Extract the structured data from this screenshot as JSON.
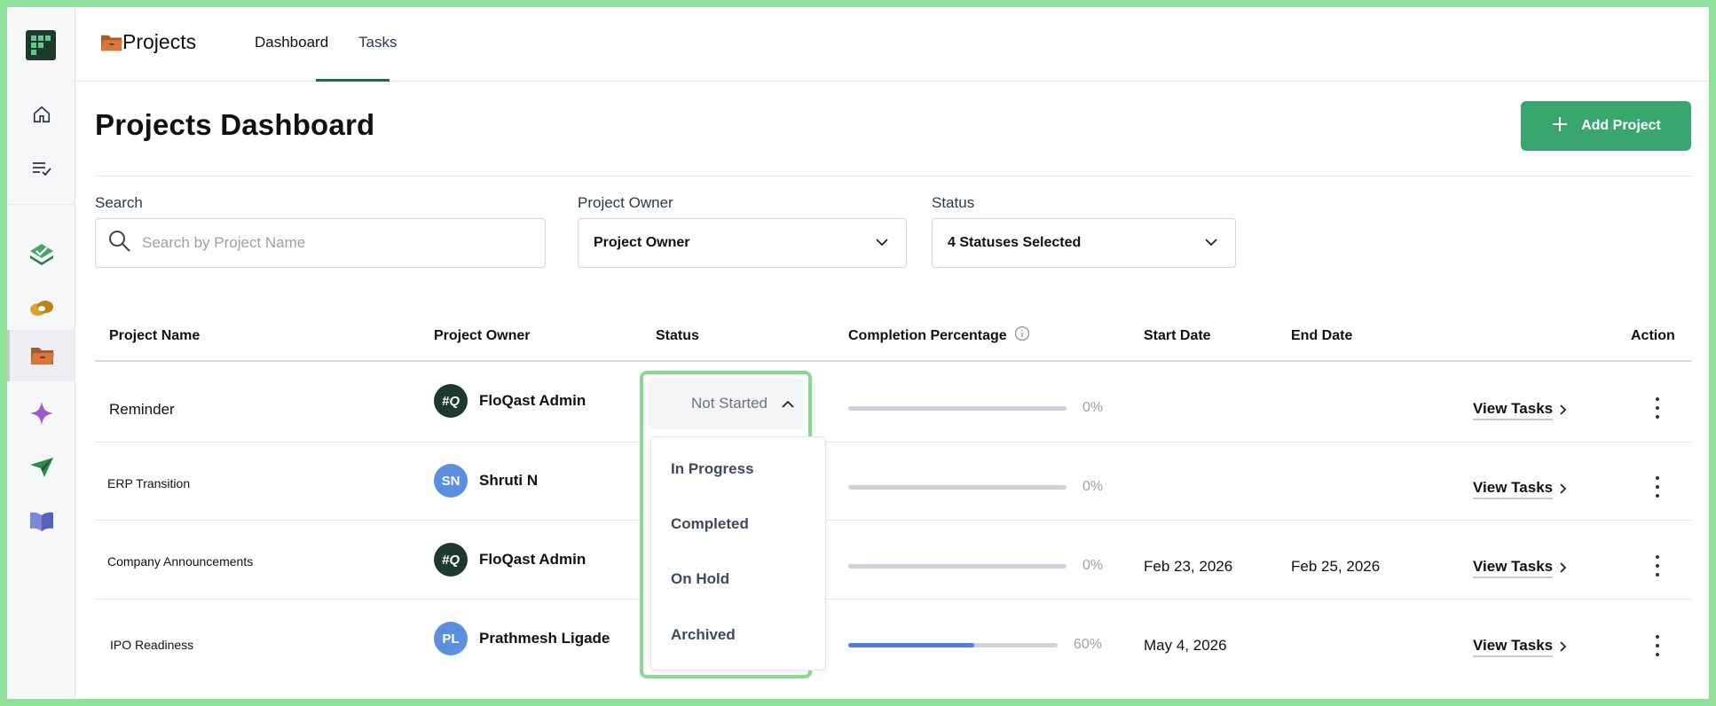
{
  "app": {
    "title": "Projects"
  },
  "tabs": [
    {
      "label": "Dashboard",
      "active": true
    },
    {
      "label": "Tasks",
      "active": false
    }
  ],
  "page": {
    "title": "Projects Dashboard"
  },
  "actions": {
    "add_project": "Add Project"
  },
  "filters": {
    "search_label": "Search",
    "search_placeholder": "Search by Project Name",
    "owner_label": "Project Owner",
    "owner_value": "Project Owner",
    "status_label": "Status",
    "status_value": "4 Statuses Selected"
  },
  "table": {
    "headers": {
      "name": "Project Name",
      "owner": "Project Owner",
      "status": "Status",
      "completion": "Completion Percentage",
      "start": "Start Date",
      "end": "End Date",
      "action": "Action"
    },
    "view_tasks_label": "View Tasks",
    "rows": [
      {
        "name": "Reminder",
        "owner": "FloQast Admin",
        "initials": "#Q",
        "completion": 0,
        "completion_label": "0%",
        "start": "",
        "end": ""
      },
      {
        "name": "ERP Transition",
        "owner": "Shruti N",
        "initials": "SN",
        "completion": 0,
        "completion_label": "0%",
        "start": "",
        "end": ""
      },
      {
        "name": "Company Announcements",
        "owner": "FloQast Admin",
        "initials": "#Q",
        "completion": 0,
        "completion_label": "0%",
        "start": "Feb 23, 2026",
        "end": "Feb 25, 2026"
      },
      {
        "name": "IPO Readiness",
        "owner": "Prathmesh Ligade",
        "initials": "PL",
        "completion": 60,
        "completion_label": "60%",
        "start": "May 4, 2026",
        "end": ""
      }
    ]
  },
  "status_dropdown": {
    "current": "Not Started",
    "options": [
      "In Progress",
      "Completed",
      "On Hold",
      "Archived"
    ]
  },
  "colors": {
    "accent": "#3aa66f",
    "progress": "#4f7be8",
    "highlight": "#86db8f"
  },
  "icons": {
    "sidebar": [
      "home-icon",
      "task-list-icon",
      "checkbox-stack-icon",
      "reconciliation-icon",
      "projects-folder-icon",
      "sparkle-icon",
      "send-icon",
      "book-icon"
    ]
  }
}
